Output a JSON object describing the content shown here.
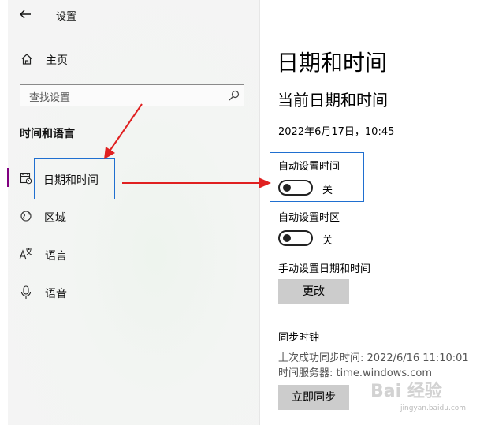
{
  "window": {
    "title": "设置"
  },
  "sidebar": {
    "home": "主页",
    "search_placeholder": "查找设置",
    "section_title": "时间和语言",
    "items": [
      {
        "label": "日期和时间"
      },
      {
        "label": "区域"
      },
      {
        "label": "语言"
      },
      {
        "label": "语音"
      }
    ]
  },
  "main": {
    "title": "日期和时间",
    "subtitle": "当前日期和时间",
    "current_datetime": "2022年6月17日，10:45",
    "auto_time": {
      "label": "自动设置时间",
      "state": "关"
    },
    "auto_timezone": {
      "label": "自动设置时区",
      "state": "关"
    },
    "manual": {
      "label": "手动设置日期和时间",
      "button": "更改"
    },
    "sync": {
      "title": "同步时钟",
      "last_sync": "上次成功同步时间: 2022/6/16 11:10:01",
      "server": "时间服务器: time.windows.com",
      "button": "立即同步"
    }
  },
  "watermark": {
    "brand": "Bai 经验",
    "url": "jingyan.baidu.com"
  },
  "colors": {
    "accent": "#800080",
    "annotation_red": "#e02020",
    "annotation_blue": "#1f6fd0"
  }
}
